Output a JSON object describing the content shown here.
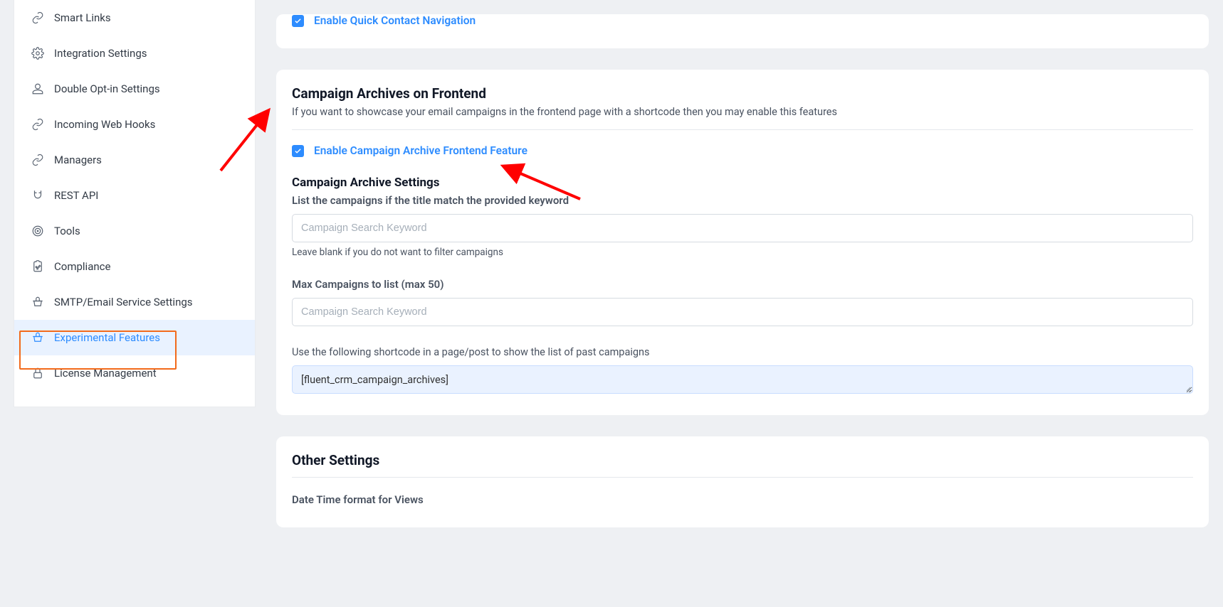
{
  "sidebar": {
    "items": [
      {
        "label": "Smart Links"
      },
      {
        "label": "Integration Settings"
      },
      {
        "label": "Double Opt-in Settings"
      },
      {
        "label": "Incoming Web Hooks"
      },
      {
        "label": "Managers"
      },
      {
        "label": "REST API"
      },
      {
        "label": "Tools"
      },
      {
        "label": "Compliance"
      },
      {
        "label": "SMTP/Email Service Settings"
      },
      {
        "label": "Experimental Features"
      },
      {
        "label": "License Management"
      }
    ]
  },
  "top_checkbox": {
    "label": "Enable Quick Contact Navigation"
  },
  "archive": {
    "title": "Campaign Archives on Frontend",
    "desc": "If you want to showcase your email campaigns in the frontend page with a shortcode then you may enable this features",
    "enable_label": "Enable Campaign Archive Frontend Feature",
    "settings_title": "Campaign Archive Settings",
    "keyword_label": "List the campaigns if the title match the provided keyword",
    "keyword_placeholder": "Campaign Search Keyword",
    "keyword_help": "Leave blank if you do not want to filter campaigns",
    "max_label": "Max Campaigns to list (max 50)",
    "max_placeholder": "Campaign Search Keyword",
    "shortcode_label": "Use the following shortcode in a page/post to show the list of past campaigns",
    "shortcode_value": "[fluent_crm_campaign_archives]"
  },
  "other": {
    "title": "Other Settings",
    "datetime_label": "Date Time format for Views"
  }
}
